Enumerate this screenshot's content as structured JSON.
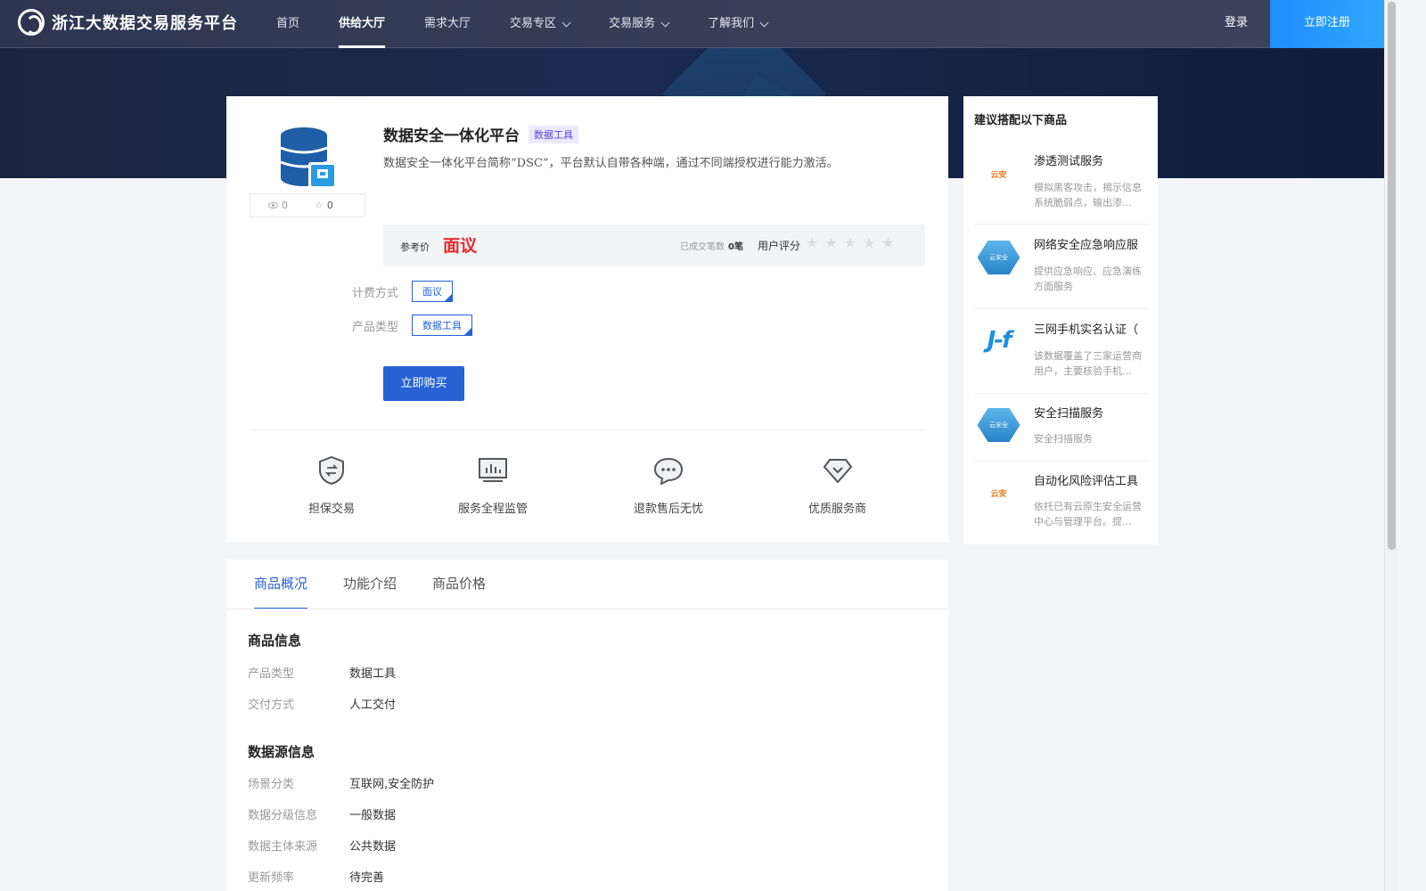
{
  "nav": {
    "logo_text": "浙江大数据交易服务平台",
    "items": [
      {
        "label": "首页",
        "dropdown": false,
        "active": false
      },
      {
        "label": "供给大厅",
        "dropdown": false,
        "active": true
      },
      {
        "label": "需求大厅",
        "dropdown": false,
        "active": false
      },
      {
        "label": "交易专区",
        "dropdown": true,
        "active": false
      },
      {
        "label": "交易服务",
        "dropdown": true,
        "active": false
      },
      {
        "label": "了解我们",
        "dropdown": true,
        "active": false
      }
    ],
    "login": "登录",
    "register": "立即注册"
  },
  "product": {
    "title": "数据安全一体化平台",
    "tag": "数据工具",
    "description": "数据安全一体化平台简称“DSC”，平台默认自带各种端，通过不同端授权进行能力激活。",
    "views": "0",
    "favorites": "0",
    "price_label": "参考价",
    "price_value": "面议",
    "deals_label": "已成交笔数",
    "deals_value": "0笔",
    "rating_label": "用户评分",
    "rating": 0,
    "billing_label": "计费方式",
    "billing_value": "面议",
    "type_label": "产品类型",
    "type_value": "数据工具",
    "buy_button": "立即购买"
  },
  "features": [
    {
      "label": "担保交易",
      "icon": "shield-exchange-icon"
    },
    {
      "label": "服务全程监管",
      "icon": "monitor-chart-icon"
    },
    {
      "label": "退款售后无忧",
      "icon": "chat-bubble-icon"
    },
    {
      "label": "优质服务商",
      "icon": "diamond-check-icon"
    }
  ],
  "recommend": {
    "title": "建议搭配以下商品",
    "items": [
      {
        "name": "渗透测试服务",
        "desc": "模拟黑客攻击，揭示信息系统脆弱点，输出渗...",
        "logo": "orange-brand-logo",
        "logo_text": "云安"
      },
      {
        "name": "网络安全应急响应服",
        "desc": "提供应急响应、应急演练方面服务",
        "logo": "blue-hex-logo",
        "logo_text": "云安全"
      },
      {
        "name": "三网手机实名认证（",
        "desc": "该数据覆盖了三家运营商用户，主要核验手机...",
        "logo": "jf-logo",
        "logo_text": "J-f"
      },
      {
        "name": "安全扫描服务",
        "desc": "安全扫描服务",
        "logo": "blue-hex-logo",
        "logo_text": "云安全"
      },
      {
        "name": "自动化风险评估工具",
        "desc": "依托已有云原生安全运营中心与管理平台。提...",
        "logo": "orange-brand-logo",
        "logo_text": "云安"
      }
    ]
  },
  "tabs": [
    "商品概况",
    "功能介绍",
    "商品价格"
  ],
  "detail": {
    "goods_info_title": "商品信息",
    "goods_info": [
      {
        "k": "产品类型",
        "v": "数据工具"
      },
      {
        "k": "交付方式",
        "v": "人工交付"
      }
    ],
    "source_info_title": "数据源信息",
    "source_info": [
      {
        "k": "场景分类",
        "v": "互联网,安全防护"
      },
      {
        "k": "数据分级信息",
        "v": "一般数据"
      },
      {
        "k": "数据主体来源",
        "v": "公共数据"
      },
      {
        "k": "更新频率",
        "v": "待完善"
      }
    ]
  },
  "colors": {
    "primary": "#2762d4",
    "price": "#e6292c",
    "nav_bg": "#2d3650",
    "register_bg": "#1f8dff"
  }
}
